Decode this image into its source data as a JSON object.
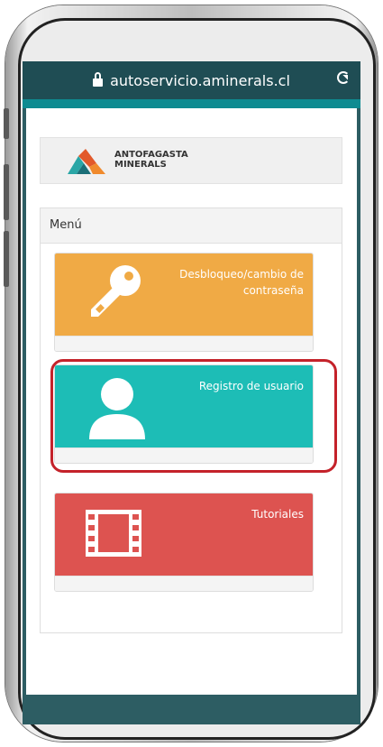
{
  "browser": {
    "url": "autoservicio.aminerals.cl"
  },
  "header": {
    "logo_line1": "ANTOFAGASTA",
    "logo_line2": "MINERALS"
  },
  "menu": {
    "title": "Menú",
    "items": [
      {
        "label": "Desbloqueo/cambio de contraseña",
        "color": "#f0aa45",
        "icon": "key-icon"
      },
      {
        "label": "Registro de usuario",
        "color": "#1dbdb6",
        "icon": "user-icon"
      },
      {
        "label": "Tutoriales",
        "color": "#dd5350",
        "icon": "film-icon"
      }
    ]
  },
  "colors": {
    "highlight": "#c4222a",
    "url_bar": "#1f4d54",
    "accent_strip": "#0e8b91"
  }
}
